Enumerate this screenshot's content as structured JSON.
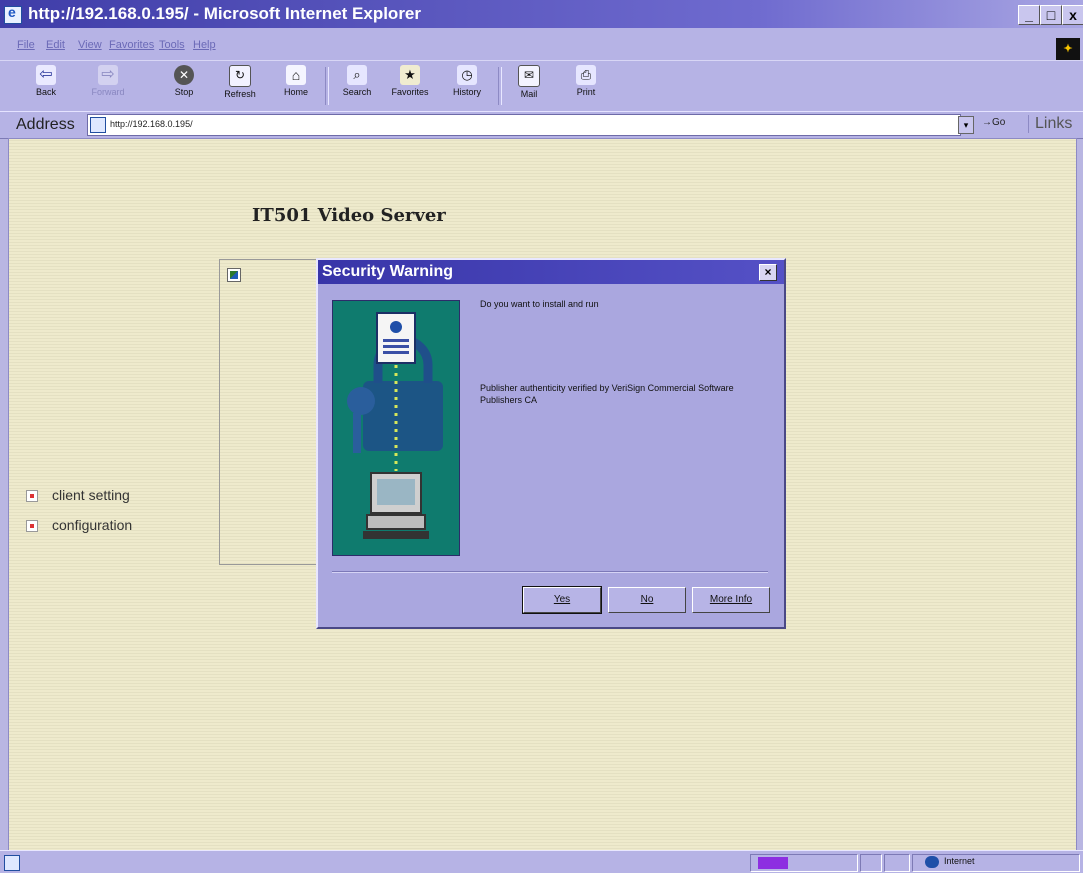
{
  "window": {
    "title": "http://192.168.0.195/ - Microsoft Internet Explorer",
    "controls": [
      "_",
      "□",
      "x"
    ]
  },
  "menu": [
    "File",
    "Edit",
    "View",
    "Favorites",
    "Tools",
    "Help"
  ],
  "toolbar": {
    "buttons": [
      {
        "label": "Back",
        "icon": "back-arrow-icon"
      },
      {
        "label": "Forward",
        "icon": "forward-arrow-icon"
      },
      {
        "label": "Stop",
        "icon": "stop-icon"
      },
      {
        "label": "Refresh",
        "icon": "refresh-icon"
      },
      {
        "label": "Home",
        "icon": "home-icon"
      },
      {
        "label": "Search",
        "icon": "search-icon"
      },
      {
        "label": "Favorites",
        "icon": "favorites-icon"
      },
      {
        "label": "History",
        "icon": "history-icon"
      },
      {
        "label": "Mail",
        "icon": "mail-icon"
      },
      {
        "label": "Print",
        "icon": "print-icon"
      }
    ]
  },
  "address": {
    "label": "Address",
    "value": "http://192.168.0.195/",
    "go": "Go",
    "links": "Links"
  },
  "page": {
    "title": "IT501 Video Server",
    "links": [
      "client setting",
      "configuration"
    ]
  },
  "dialog": {
    "title": "Security Warning",
    "question": "Do you want to install and run",
    "publisher": "Publisher authenticity verified by VeriSign Commercial Software Publishers CA",
    "buttons": {
      "yes": "Yes",
      "no": "No",
      "more": "More Info"
    }
  },
  "status": {
    "zone": "Internet"
  }
}
